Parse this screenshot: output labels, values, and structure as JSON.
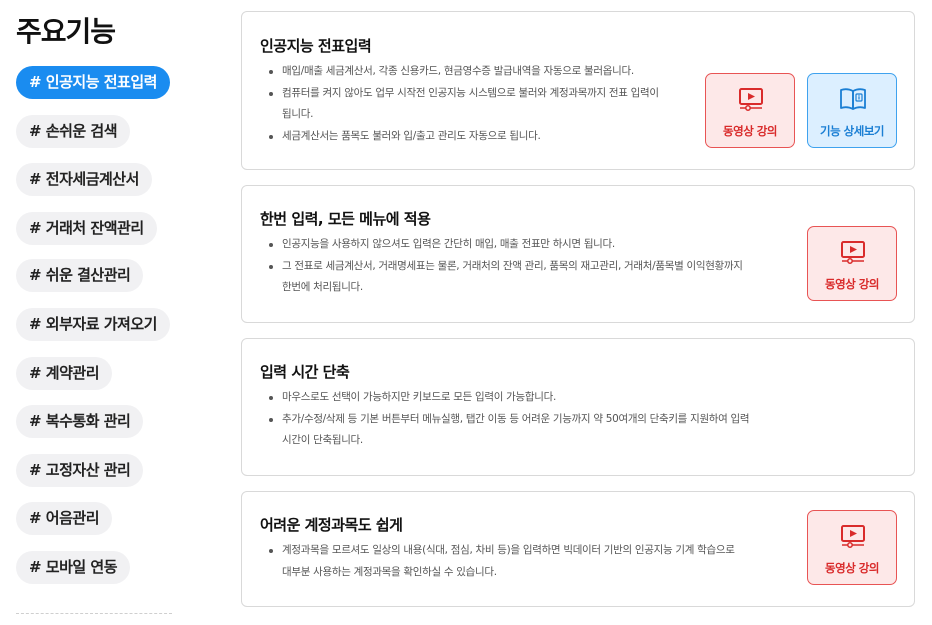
{
  "sidebar": {
    "title": "주요기능",
    "items": [
      {
        "label": "# 인공지능 전표입력",
        "active": true
      },
      {
        "label": "# 손쉬운 검색"
      },
      {
        "label": "# 전자세금계산서"
      },
      {
        "label": "# 거래처 잔액관리"
      },
      {
        "label": "# 쉬운 결산관리"
      },
      {
        "label": "# 외부자료 가져오기"
      },
      {
        "label": "# 계약관리"
      },
      {
        "label": "# 복수통화 관리"
      },
      {
        "label": "# 고정자산 관리"
      },
      {
        "label": "# 어음관리"
      },
      {
        "label": "# 모바일 연동"
      }
    ]
  },
  "cards": [
    {
      "title": "인공지능 전표입력",
      "bullets": [
        "매입/매출 세금계산서, 각종 신용카드, 현금영수증 발급내역을 자동으로 불러옵니다.",
        "컴퓨터를 켜지 않아도 업무 시작전 인공지능 시스템으로 불러와 계정과목까지 전표 입력이",
        "됩니다.",
        "세금계산서는 품목도 불러와 입/출고 관리도 자동으로 됩니다."
      ],
      "video_label": "동영상 강의",
      "detail_label": "기능 상세보기"
    },
    {
      "title": "한번 입력, 모든 메뉴에 적용",
      "bullets": [
        "인공지능을 사용하지 않으셔도 입력은 간단히 매입, 매출 전표만 하시면 됩니다.",
        "그 전표로 세금계산서, 거래명세표는 물론, 거래처의 잔액 관리, 품목의 재고관리, 거래처/품목별 이익현황까지",
        "한번에 처리됩니다."
      ],
      "video_label": "동영상 강의"
    },
    {
      "title": "입력 시간 단축",
      "bullets": [
        "마우스로도 선택이 가능하지만 키보드로 모든 입력이 가능합니다.",
        "추가/수정/삭제 등 기본 버튼부터 메뉴실행, 탭간 이동 등 어려운 기능까지 약 50여개의 단축키를 지원하여 입력",
        "시간이 단축됩니다."
      ]
    },
    {
      "title": "어려운 계정과목도 쉽게",
      "bullets": [
        "계정과목을 모르셔도 일상의 내용(식대, 점심, 차비 등)을 입력하면 빅데이터 기반의 인공지능 기계 학습으로",
        "대부분 사용하는 계정과목을 확인하실 수 있습니다."
      ],
      "video_label": "동영상 강의"
    }
  ],
  "icons": {
    "video": "video-lecture-icon",
    "detail": "book-info-icon"
  },
  "colors": {
    "accent": "#1a8cf0",
    "video_bg": "#fde8e8",
    "video_border": "#e85454",
    "video_text": "#d92b2b",
    "detail_bg": "#dcefff",
    "detail_border": "#3fa2ee",
    "detail_text": "#1b7fd4"
  }
}
